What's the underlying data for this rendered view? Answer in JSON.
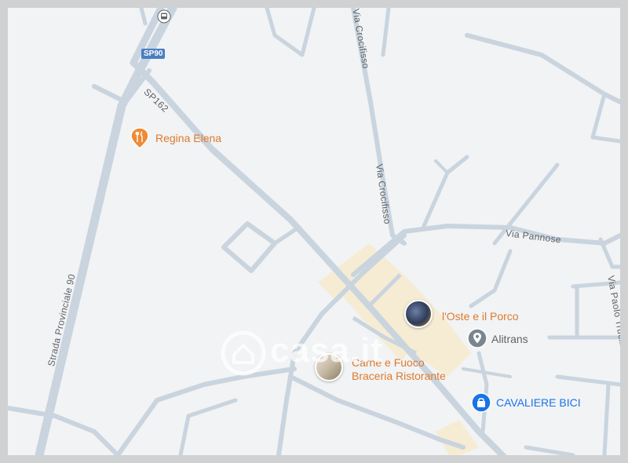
{
  "roads": {
    "sp90_badge": "SP90",
    "sp162": "SP162",
    "strada_provinciale_90": "Strada Provinciale 90",
    "via_crocifisso_top": "Via Crocifisso",
    "via_crocifisso_mid": "Via Crocifisso",
    "via_pannose": "Via Pannose",
    "via_paolo": "Via Paolo Trucili"
  },
  "pois": {
    "regina_elena": "Regina Elena",
    "oste_porco": "l'Oste e il Porco",
    "alitrans": "Alitrans",
    "carne_fuoco_1": "Carne e Fuoco",
    "carne_fuoco_2": "Braceria Ristorante",
    "cavaliere_bici": "CAVALIERE BICI"
  },
  "watermark": "casa.it",
  "colors": {
    "road": "#c9d4de",
    "road_outline": "#ffffff",
    "poi_orange": "#e07a2d",
    "poi_blue": "#1a73e8",
    "poi_grey": "#5f6368",
    "highlight_area": "#f6ecd4"
  }
}
